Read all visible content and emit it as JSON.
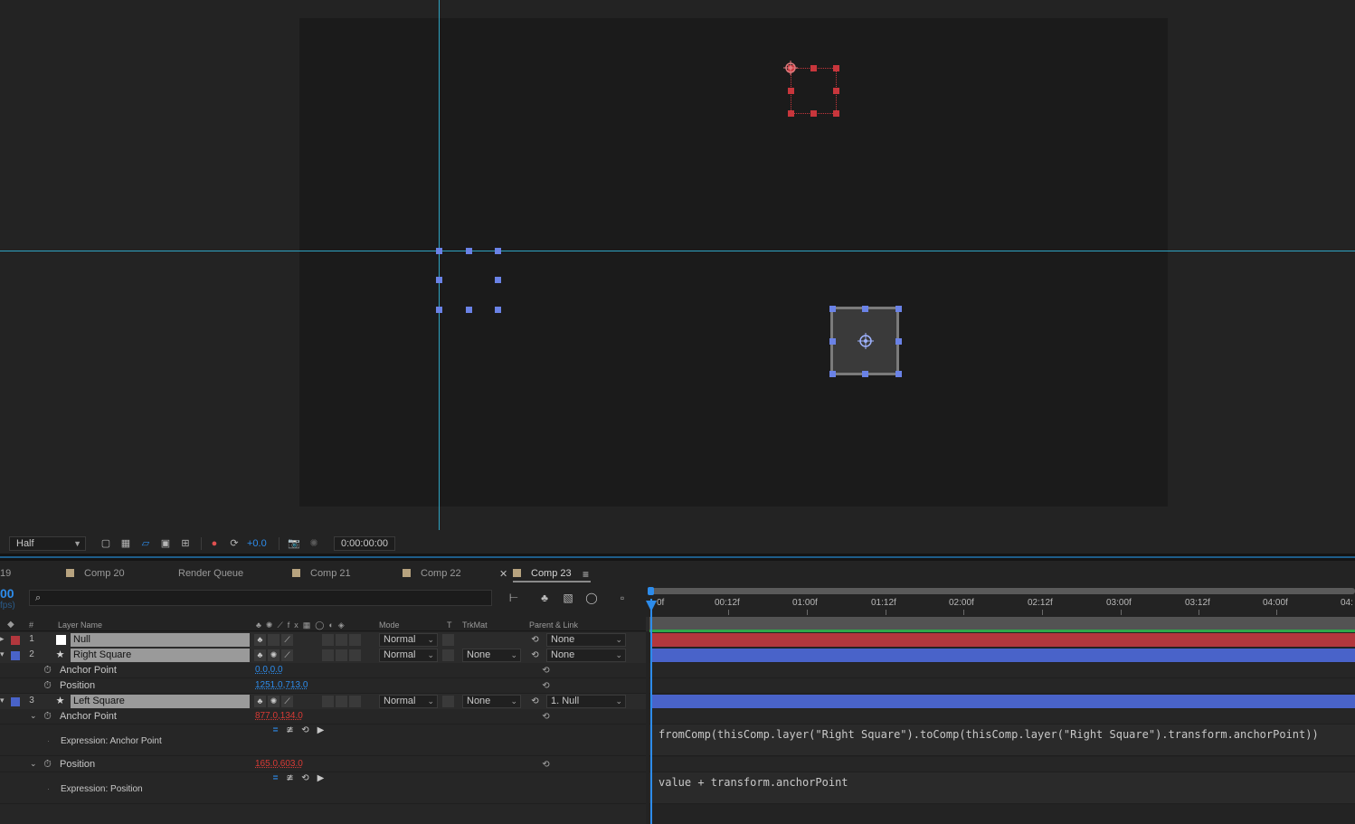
{
  "viewer": {
    "resolution": "Half",
    "exposure": "+0.0",
    "timecode": "0:00:00:00"
  },
  "tabs": [
    {
      "label": "19"
    },
    {
      "label": "Comp 20"
    },
    {
      "label": "Render Queue"
    },
    {
      "label": "Comp 21"
    },
    {
      "label": "Comp 22"
    },
    {
      "label": "Comp 23"
    }
  ],
  "timeline": {
    "current_time": "00",
    "fps": "fps)",
    "search_placeholder": "",
    "ruler": [
      "0f",
      "00:12f",
      "01:00f",
      "01:12f",
      "02:00f",
      "02:12f",
      "03:00f",
      "03:12f",
      "04:00f",
      "04:"
    ],
    "columns": {
      "num": "#",
      "layer_name": "Layer Name",
      "mode": "Mode",
      "t": "T",
      "trkmat": "TrkMat",
      "parent": "Parent & Link"
    }
  },
  "layers": [
    {
      "num": "1",
      "name": "Null",
      "mode": "Normal",
      "trkmat": "",
      "parent": "None",
      "color": "#b2373d"
    },
    {
      "num": "2",
      "name": "Right Square",
      "mode": "Normal",
      "trkmat": "None",
      "parent": "None",
      "color": "#4963c9",
      "props": [
        {
          "name": "Anchor Point",
          "value": "0.0,0.0"
        },
        {
          "name": "Position",
          "value": "1251.0,713.0"
        }
      ]
    },
    {
      "num": "3",
      "name": "Left Square",
      "mode": "Normal",
      "trkmat": "None",
      "parent": "1. Null",
      "color": "#4963c9",
      "props": [
        {
          "name": "Anchor Point",
          "value": "877.0,134.0",
          "expression_label": "Expression: Anchor Point",
          "expression": "fromComp(thisComp.layer(\"Right Square\").toComp(thisComp.layer(\"Right Square\").transform.anchorPoint))"
        },
        {
          "name": "Position",
          "value": "165.0,603.0",
          "expression_label": "Expression: Position",
          "expression": "value + transform.anchorPoint"
        }
      ]
    }
  ],
  "colors": {
    "accent": "#2d8ceb",
    "guide": "#2ea3c2",
    "null_label": "#b2373d",
    "shape_label": "#4963c9",
    "expression_value": "#d93a35"
  }
}
